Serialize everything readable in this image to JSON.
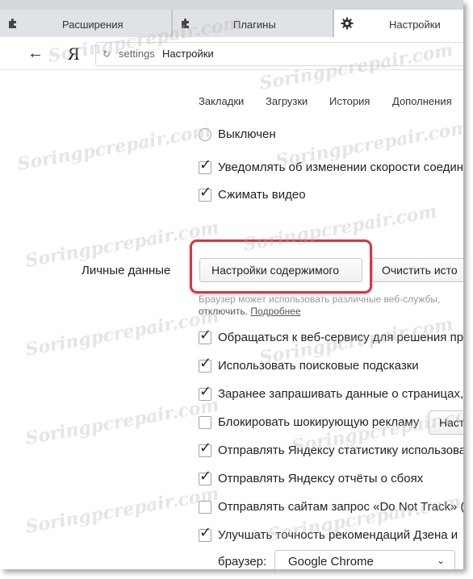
{
  "tabs": [
    {
      "label": "Расширения",
      "icon": "puzzle-icon"
    },
    {
      "label": "Плагины",
      "icon": "puzzle-icon"
    },
    {
      "label": "Настройки",
      "icon": "gear-icon"
    }
  ],
  "address_bar": {
    "logo": "Я",
    "path": "settings",
    "page_title": "Настройки"
  },
  "settings_nav": [
    "Закладки",
    "Загрузки",
    "История",
    "Дополнения"
  ],
  "top_options": {
    "radio_off": "Выключен",
    "notify_speed": "Уведомлять об изменении скорости соедин",
    "compress_video": "Сжимать видео"
  },
  "privacy": {
    "section_label": "Личные данные",
    "content_settings_button": "Настройки содержимого",
    "clear_history_button": "Очистить исто",
    "description_line1": "Браузер может использовать различные веб-службы,",
    "description_line2": "отключить.",
    "more_link": "Подробнее",
    "options": [
      {
        "label": "Обращаться к веб-сервису для решения пр",
        "checked": true
      },
      {
        "label": "Использовать поисковые подсказки",
        "checked": true
      },
      {
        "label": "Заранее запрашивать данные о страницах,",
        "checked": true
      },
      {
        "label": "Блокировать шокирующую рекламу",
        "checked": false
      },
      {
        "label": "Отправлять Яндексу статистику использова",
        "checked": true
      },
      {
        "label": "Отправлять Яндексу отчёты о сбоях",
        "checked": true
      },
      {
        "label": "Отправлять сайтам запрос «Do Not Track» («",
        "checked": false
      },
      {
        "label": "Улучшать точность рекомендаций Дзена и",
        "checked": true
      }
    ],
    "block_ads_button": "Наст",
    "browser_label": "браузер:",
    "browser_select": "Google Chrome"
  },
  "watermark": "Soringpcrepair.com",
  "colors": {
    "highlight": "#d9363b",
    "tabbar": "#d4d7dc"
  }
}
